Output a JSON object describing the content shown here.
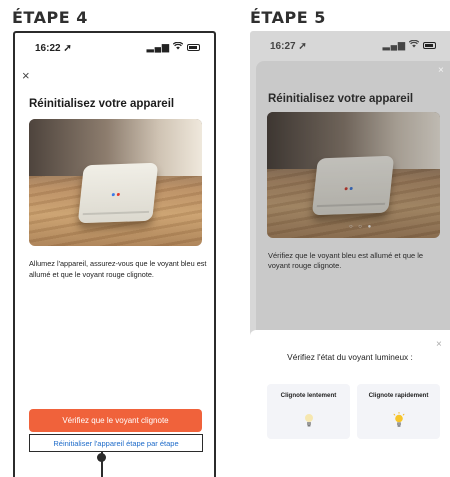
{
  "steps": {
    "step4": {
      "label": "ÉTAPE 4",
      "status_time": "16:22",
      "title": "Réinitialisez votre appareil",
      "instructions": "Allumez l'appareil, assurez-vous que le voyant bleu est allumé et que le voyant rouge clignote.",
      "primary_button": "Vérifiez que le voyant clignote",
      "secondary_button": "Réinitialiser l'appareil étape par étape"
    },
    "step5": {
      "label": "ÉTAPE 5",
      "status_time": "16:27",
      "title": "Réinitialisez votre appareil",
      "instructions": "Vérifiez que le voyant bleu est allumé et que le voyant rouge clignote.",
      "sheet": {
        "title": "Vérifiez l'état du voyant lumineux :",
        "options": [
          {
            "label": "Clignote lentement",
            "icon": "bulb-dim-icon"
          },
          {
            "label": "Clignote rapidement",
            "icon": "bulb-lit-icon"
          }
        ]
      }
    }
  },
  "icons": {
    "close": "×",
    "location": "➚",
    "signal": "▂▄▆",
    "wifi": "wifi-icon",
    "battery": "battery-icon"
  },
  "colors": {
    "primary_button": "#f0623b",
    "link_text": "#1e6bc9",
    "led_blue": "#3b7be8",
    "led_red": "#e23a2e"
  }
}
